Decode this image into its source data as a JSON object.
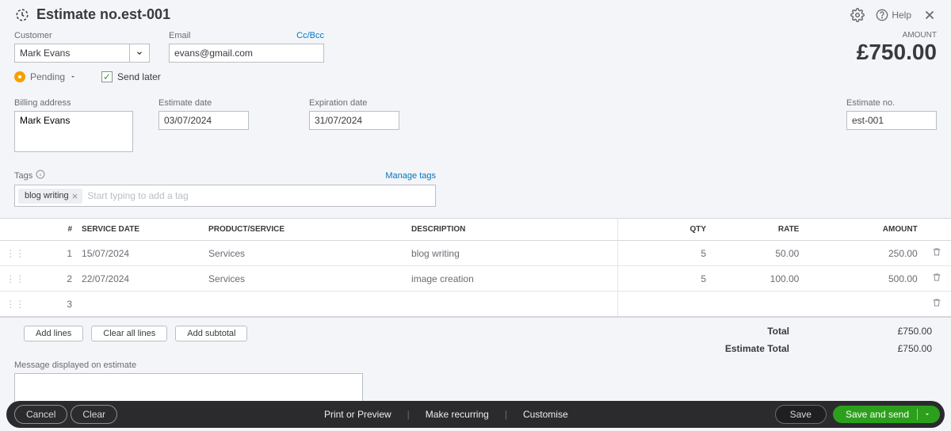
{
  "title": "Estimate no.est-001",
  "help_label": "Help",
  "amount": {
    "label": "AMOUNT",
    "value": "£750.00"
  },
  "customer": {
    "label": "Customer",
    "value": "Mark Evans"
  },
  "email": {
    "label": "Email",
    "value": "evans@gmail.com",
    "ccbcc": "Cc/Bcc"
  },
  "status": {
    "label": "Pending"
  },
  "send_later_label": "Send later",
  "billing": {
    "label": "Billing address",
    "value": "Mark Evans"
  },
  "estimate_date": {
    "label": "Estimate date",
    "value": "03/07/2024"
  },
  "expiration_date": {
    "label": "Expiration date",
    "value": "31/07/2024"
  },
  "estimate_no": {
    "label": "Estimate no.",
    "value": "est-001"
  },
  "tags": {
    "label": "Tags",
    "manage": "Manage tags",
    "chip": "blog writing",
    "placeholder": "Start typing to add a tag"
  },
  "table": {
    "headers": {
      "num": "#",
      "service_date": "SERVICE DATE",
      "product": "PRODUCT/SERVICE",
      "description": "DESCRIPTION",
      "qty": "QTY",
      "rate": "RATE",
      "amount": "AMOUNT"
    },
    "rows": [
      {
        "num": "1",
        "service_date": "15/07/2024",
        "product": "Services",
        "description": "blog writing",
        "qty": "5",
        "rate": "50.00",
        "amount": "250.00"
      },
      {
        "num": "2",
        "service_date": "22/07/2024",
        "product": "Services",
        "description": "image creation",
        "qty": "5",
        "rate": "100.00",
        "amount": "500.00"
      },
      {
        "num": "3",
        "service_date": "",
        "product": "",
        "description": "",
        "qty": "",
        "rate": "",
        "amount": ""
      }
    ]
  },
  "line_buttons": {
    "add": "Add lines",
    "clear": "Clear all lines",
    "subtotal": "Add subtotal"
  },
  "totals": {
    "total_label": "Total",
    "total_value": "£750.00",
    "est_total_label": "Estimate Total",
    "est_total_value": "£750.00"
  },
  "message_label": "Message displayed on estimate",
  "bottombar": {
    "cancel": "Cancel",
    "clear": "Clear",
    "print": "Print or Preview",
    "recurring": "Make recurring",
    "customise": "Customise",
    "save": "Save",
    "send": "Save and send"
  }
}
